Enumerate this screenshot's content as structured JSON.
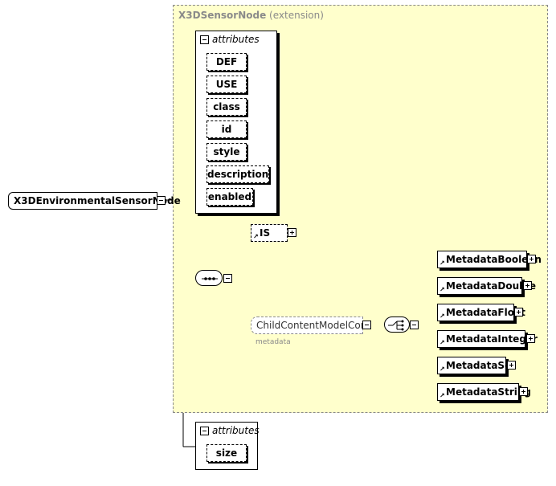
{
  "extension": {
    "title": "X3DSensorNode",
    "subtitle": "(extension)"
  },
  "root": {
    "label": "X3DEnvironmentalSensorNode"
  },
  "attributes_top": {
    "title": "attributes",
    "items": [
      "DEF",
      "USE",
      "class",
      "id",
      "style",
      "description",
      "enabled"
    ]
  },
  "attributes_bottom": {
    "title": "attributes",
    "items": [
      "size"
    ]
  },
  "is_element": {
    "label": "IS"
  },
  "group": {
    "label": "ChildContentModelCore",
    "sublabel": "metadata"
  },
  "metadata_elements": [
    "MetadataBoolean",
    "MetadataDouble",
    "MetadataFloat",
    "MetadataInteger",
    "MetadataSet",
    "MetadataString"
  ],
  "colors": {
    "extension_bg": "#ffffcc",
    "extension_border": "#8a8a8a",
    "line": "#000000"
  }
}
